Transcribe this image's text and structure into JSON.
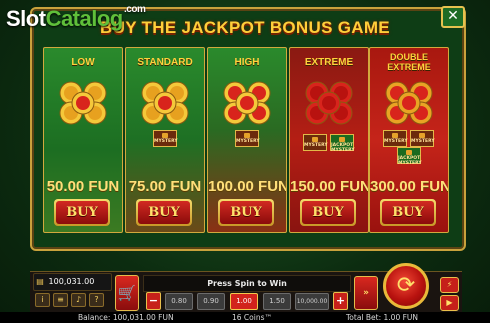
{
  "watermark": {
    "slot": "Slot",
    "catalog": "Catalog",
    "com": ".com"
  },
  "dialog": {
    "title": "BUY THE JACKPOT BONUS GAME",
    "close_symbol": "✕",
    "options": [
      {
        "name": "LOW",
        "price": "50.00 FUN",
        "buy_label": "BUY",
        "extras": []
      },
      {
        "name": "STANDARD",
        "price": "75.00 FUN",
        "buy_label": "BUY",
        "extras": [
          "MYSTERY"
        ]
      },
      {
        "name": "HIGH",
        "price": "100.00 FUN",
        "buy_label": "BUY",
        "extras": [
          "MYSTERY"
        ]
      },
      {
        "name": "EXTREME",
        "price": "150.00 FUN",
        "buy_label": "BUY",
        "extras": [
          "MYSTERY",
          "JACKPOT MYSTERY"
        ]
      },
      {
        "name": "DOUBLE EXTREME",
        "price": "300.00 FUN",
        "buy_label": "BUY",
        "extras": [
          "MYSTERY",
          "MYSTERY",
          "JACKPOT MYSTERY"
        ]
      }
    ]
  },
  "controls": {
    "balance_value": "100,031.00",
    "message": "Press Spin to Win",
    "bets": [
      "0.80",
      "0.90",
      "1.00",
      "1.50",
      "10,000.00"
    ],
    "selected_bet": "1.00",
    "minus_label": "−",
    "plus_label": "+",
    "icons": [
      "wallet-icon",
      "info-icon",
      "menu-icon",
      "sound-icon",
      "help-icon",
      "cart-icon",
      "autoplay-icon",
      "spin-icon",
      "turbo-icon",
      "play-icon"
    ]
  },
  "footer": {
    "balance": "Balance: 100,031.00 FUN",
    "game": "16 Coins™",
    "total_bet": "Total Bet: 1.00 FUN"
  },
  "colors": {
    "gold": "#ffcf3a",
    "buy_red": "#d22a22",
    "panel_green": "#0e3d15"
  }
}
